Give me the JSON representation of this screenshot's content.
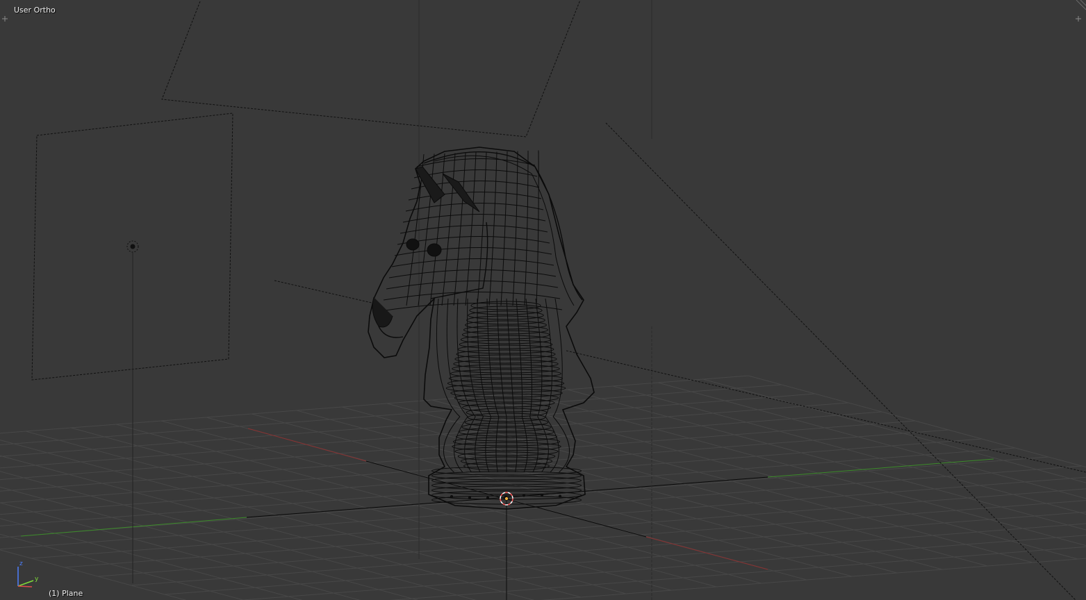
{
  "viewport": {
    "view_name": "User Ortho",
    "active_object": "(1) Plane",
    "background_color": "#393939",
    "shading": "wireframe",
    "grid_color": "#4a4a4a",
    "x_axis_color": "#8b3232",
    "y_axis_color": "#3c8c2a",
    "wire_color": "#000000"
  },
  "gizmo": {
    "z_label": "z",
    "y_label": "y",
    "z_color": "#4d7fff",
    "y_color": "#7fdc3a",
    "x_color": "#e04b4b"
  },
  "widgets": {
    "left_corner_icon": "plus-icon",
    "right_corner_icon": "plus-icon"
  }
}
